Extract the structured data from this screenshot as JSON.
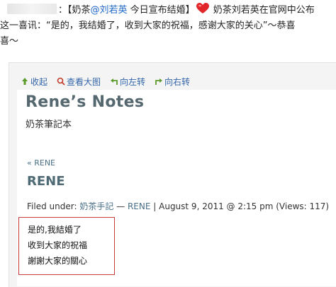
{
  "post": {
    "mention_prefix": "：【奶茶",
    "mention_user": "@刘若英",
    "mention_suffix": " 今日宣布结婚】",
    "line1_tail": " 奶茶刘若英在官网中公布",
    "line2": "这一喜讯：“是的，我结婚了，收到大家的祝福，感谢大家的关心”～恭喜",
    "line3": "喜～"
  },
  "toolbar": {
    "collapse_label": "收起",
    "view_large_label": "查看大图",
    "rotate_left_label": "向左转",
    "rotate_right_label": "向右转"
  },
  "screenshot": {
    "blog_title": "Rene’s Notes",
    "blog_subtitle": "奶茶筆記本",
    "back_link": "« RENE",
    "post_title": "RENE",
    "filed_prefix": "Filed under: ",
    "filed_category": "奶茶手記",
    "filed_sep": " — ",
    "filed_author": "RENE",
    "filed_meta": " | August 9, 2011 @ 2:15 pm (Views: 117)",
    "note_lines": [
      "是的,我結婚了",
      "收到大家的祝福",
      "謝謝大家的關心"
    ]
  },
  "colors": {
    "link": "#3366aa",
    "mention": "#1a66c6",
    "heart": "#e0262b",
    "highlight_border": "#c93a3a"
  },
  "icons": {
    "collapse": "up-arrow-icon",
    "view_large": "magnifier-icon",
    "rotate_left": "rotate-left-icon",
    "rotate_right": "rotate-right-icon",
    "heart": "heart-emoji-icon"
  }
}
